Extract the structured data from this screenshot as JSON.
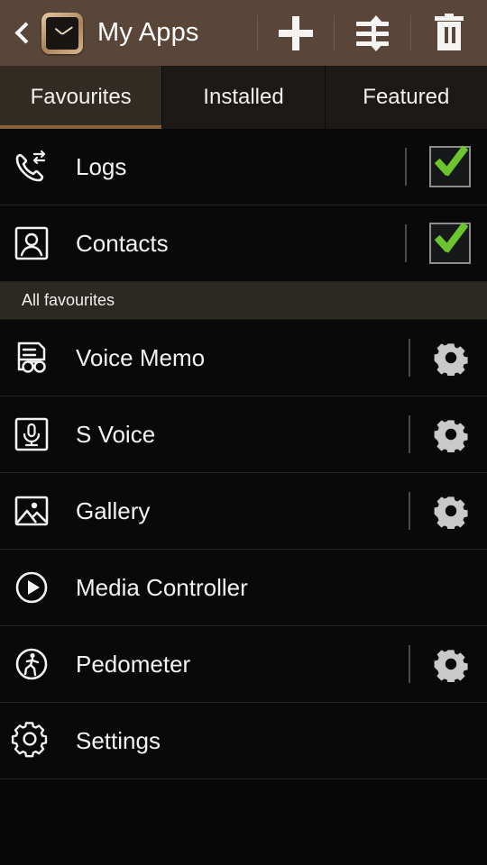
{
  "header": {
    "back_icon": "back-chevron-icon",
    "watch_icon": "smartwatch-icon",
    "title": "My Apps",
    "actions": [
      {
        "name": "add-button",
        "icon": "plus-icon"
      },
      {
        "name": "reorder-button",
        "icon": "reorder-icon"
      },
      {
        "name": "delete-button",
        "icon": "trash-icon"
      }
    ]
  },
  "tabs": [
    {
      "label": "Favourites",
      "active": true
    },
    {
      "label": "Installed",
      "active": false
    },
    {
      "label": "Featured",
      "active": false
    }
  ],
  "top_items": [
    {
      "label": "Logs",
      "icon": "call-logs-icon",
      "checked": true
    },
    {
      "label": "Contacts",
      "icon": "contacts-icon",
      "checked": true
    }
  ],
  "section": {
    "title": "All favourites"
  },
  "favourites": [
    {
      "label": "Voice Memo",
      "icon": "voice-memo-icon",
      "has_settings": true
    },
    {
      "label": "S Voice",
      "icon": "s-voice-icon",
      "has_settings": true
    },
    {
      "label": "Gallery",
      "icon": "gallery-icon",
      "has_settings": true
    },
    {
      "label": "Media Controller",
      "icon": "media-controller-icon",
      "has_settings": false
    },
    {
      "label": "Pedometer",
      "icon": "pedometer-icon",
      "has_settings": true
    },
    {
      "label": "Settings",
      "icon": "settings-gear-icon",
      "has_settings": false
    }
  ],
  "colors": {
    "header_bg": "#594639",
    "tab_active_bg": "#322b23",
    "tab_underline": "#8a6038",
    "section_bg": "#2c2822",
    "check_green": "#6cc52f",
    "gear_grey": "#c9c9c9",
    "body_bg": "#070707"
  }
}
